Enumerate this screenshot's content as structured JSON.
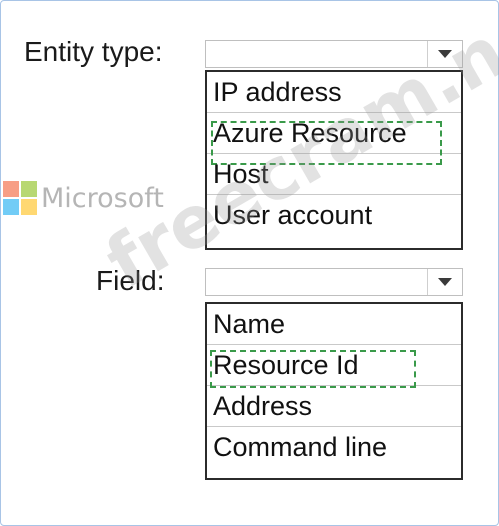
{
  "entity": {
    "label": "Entity type:",
    "selected_value": "",
    "options": [
      "IP address",
      "Azure Resource",
      "Host",
      "User account"
    ],
    "highlighted_index": 1
  },
  "field": {
    "label": "Field:",
    "selected_value": "",
    "options": [
      "Name",
      "Resource Id",
      "Address",
      "Command line"
    ],
    "highlighted_index": 1
  },
  "watermark": {
    "text": "freecram.net",
    "brand": "Microsoft"
  },
  "colors": {
    "selection_dash": "#3a9a4a",
    "list_border": "#2b2b2b",
    "frame_border": "#a8c4e6",
    "logo_red": "#f25022",
    "logo_green": "#7fba00",
    "logo_blue": "#00a4ef",
    "logo_yellow": "#ffb900"
  }
}
